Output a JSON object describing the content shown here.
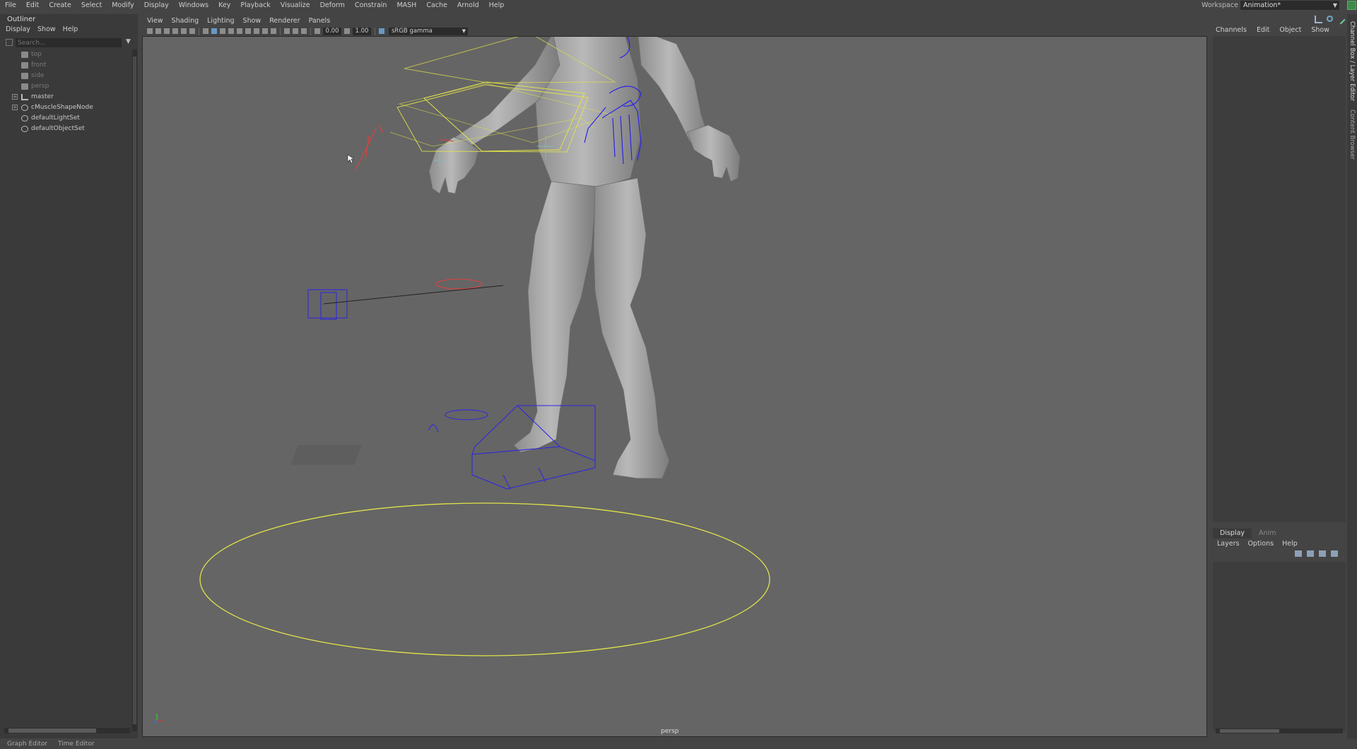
{
  "menubar": {
    "items": [
      "File",
      "Edit",
      "Create",
      "Select",
      "Modify",
      "Display",
      "Windows",
      "Key",
      "Playback",
      "Visualize",
      "Deform",
      "Constrain",
      "MASH",
      "Cache",
      "Arnold",
      "Help"
    ],
    "workspace_label": "Workspace :",
    "workspace_value": "Animation*"
  },
  "outliner": {
    "title": "Outliner",
    "menu": [
      "Display",
      "Show",
      "Help"
    ],
    "search_placeholder": "Search...",
    "items": [
      {
        "label": "top",
        "icon": "camera-icon",
        "dim": true
      },
      {
        "label": "front",
        "icon": "camera-icon",
        "dim": true
      },
      {
        "label": "side",
        "icon": "camera-icon",
        "dim": true
      },
      {
        "label": "persp",
        "icon": "camera-icon",
        "dim": true
      },
      {
        "label": "master",
        "icon": "transform-icon",
        "expand": "+"
      },
      {
        "label": "cMuscleShapeNode",
        "icon": "set-icon",
        "expand": "+"
      },
      {
        "label": "defaultLightSet",
        "icon": "set-icon"
      },
      {
        "label": "defaultObjectSet",
        "icon": "set-icon"
      }
    ]
  },
  "viewport": {
    "menu": [
      "View",
      "Shading",
      "Lighting",
      "Show",
      "Renderer",
      "Panels"
    ],
    "exposure": "0.00",
    "gamma": "1.00",
    "color_space": "sRGB gamma",
    "camera_label": "persp"
  },
  "channelbox": {
    "tabs": [
      "Channels",
      "Edit",
      "Object",
      "Show"
    ],
    "side_label_1": "Channel Box / Layer Editor",
    "side_label_2": "Content Browser"
  },
  "layer_editor": {
    "tabs": [
      "Display",
      "Anim"
    ],
    "menu": [
      "Layers",
      "Options",
      "Help"
    ]
  },
  "bottom": {
    "tab1": "Graph Editor",
    "tab2": "Time Editor"
  },
  "colors": {
    "viewport_bg": "#656565",
    "selection_yellow": "#e2e34a",
    "control_blue": "#2b24e8",
    "control_red": "#e04040"
  }
}
